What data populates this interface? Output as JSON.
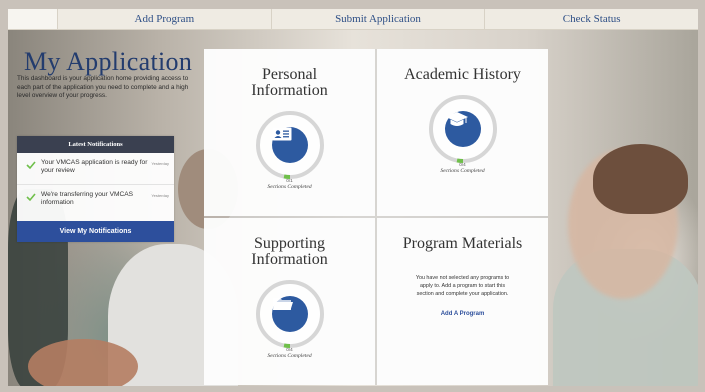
{
  "nav": {
    "tabs": [
      {
        "label": "Add Program"
      },
      {
        "label": "Submit Application"
      },
      {
        "label": "Check Status"
      }
    ]
  },
  "intro": {
    "title": "My Application",
    "description": "This dashboard is your application home providing access to each part of the application you need to complete and a high level overview of your progress."
  },
  "notifications": {
    "header": "Latest Notifications",
    "items": [
      {
        "text": "Your VMCAS application is ready for your review",
        "date": "Yesterday"
      },
      {
        "text": "We're transferring your VMCAS information",
        "date": "Yesterday"
      }
    ],
    "button_label": "View My Notifications"
  },
  "cards": {
    "personal": {
      "title": "Personal Information",
      "count": "0/1",
      "progress": 0,
      "label": "Sections Completed",
      "icon": "id-card-icon"
    },
    "academic": {
      "title": "Academic History",
      "count": "0/4",
      "progress": 0,
      "label": "Sections Completed",
      "icon": "graduation-cap-icon"
    },
    "supporting": {
      "title": "Supporting Information",
      "count": "0/4",
      "progress": 0,
      "label": "Sections Completed",
      "icon": "folder-icon"
    },
    "program": {
      "title": "Program Materials",
      "message": "You have not selected any programs to apply to. Add a program to start this section and complete your application.",
      "link": "Add A Program"
    }
  },
  "colors": {
    "accent": "#2d4f9c",
    "ring": "#d6d6d6",
    "ring_start": "#6fbf4a",
    "title": "#233c6e"
  }
}
